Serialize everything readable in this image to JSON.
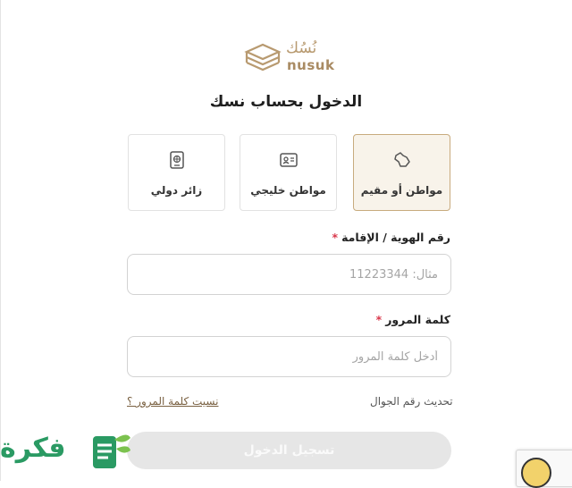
{
  "brand": {
    "name_ar": "نُسُك",
    "name_en": "nusuk"
  },
  "page_title": "الدخول بحساب نسك",
  "account_types": [
    {
      "label": "مواطن أو مقيم",
      "icon": "saudi-map-icon",
      "active": true
    },
    {
      "label": "مواطن خليجي",
      "icon": "id-card-icon",
      "active": false
    },
    {
      "label": "زائر دولي",
      "icon": "passport-icon",
      "active": false
    }
  ],
  "form": {
    "id_field": {
      "label": "رقم الهوية / الإقامة",
      "required_mark": "*",
      "placeholder": "مثال: 11223344",
      "value": ""
    },
    "password_field": {
      "label": "كلمة المرور",
      "required_mark": "*",
      "placeholder": "أدخل كلمة المرور",
      "value": ""
    },
    "forgot_password": "نسيت كلمة المرور ؟",
    "update_mobile": "تحديث رقم الجوال",
    "submit_label": "تسجيل الدخول"
  },
  "watermark": {
    "text": "فكرة"
  },
  "colors": {
    "accent": "#c8ab7e",
    "active_tab_bg": "#f8f3ea",
    "required": "#d9374b",
    "watermark": "#2a9a63"
  }
}
